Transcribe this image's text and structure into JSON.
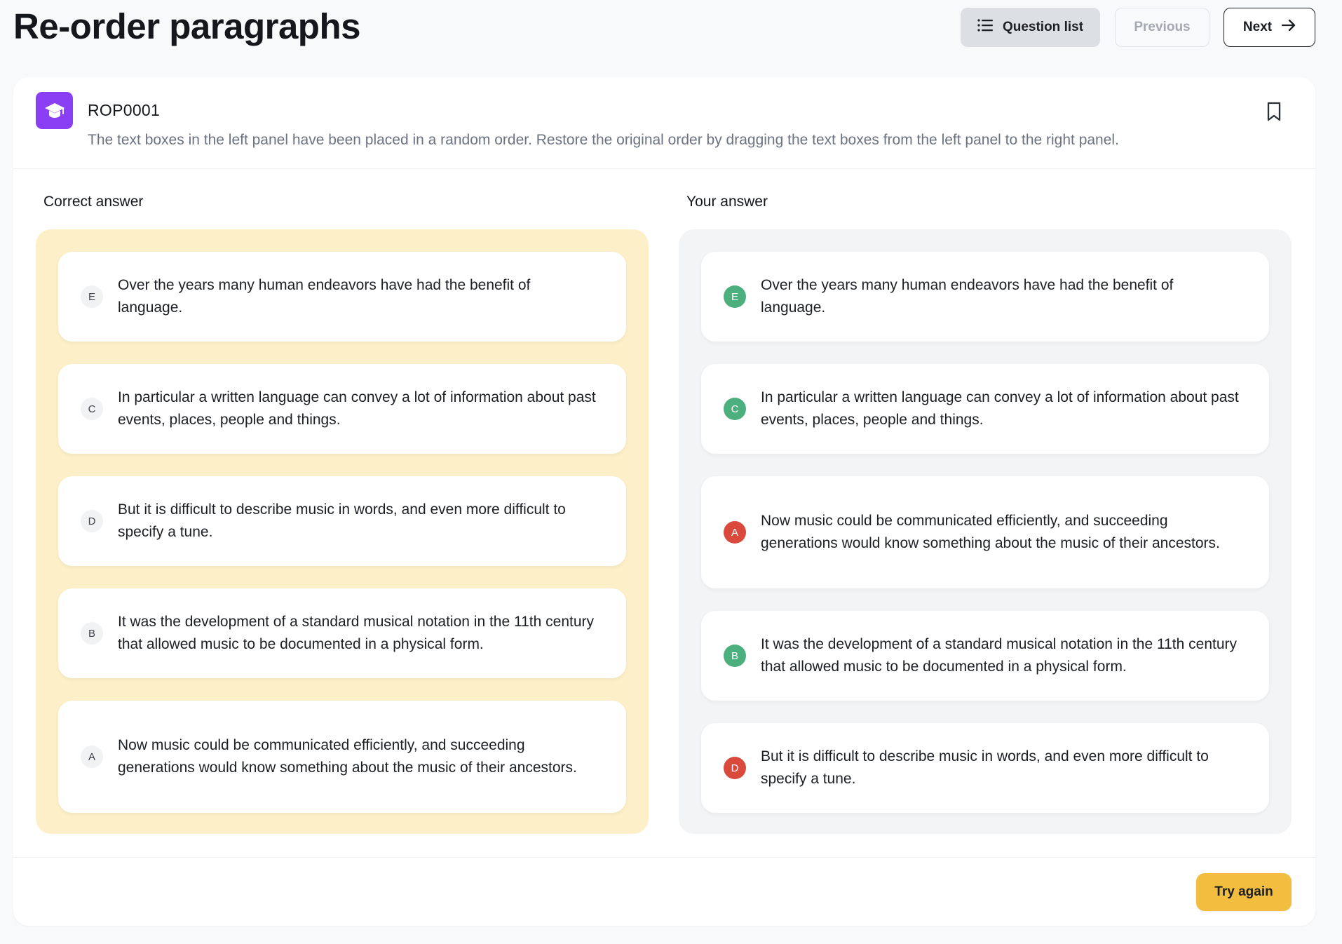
{
  "header": {
    "title": "Re-order paragraphs",
    "question_list_label": "Question list",
    "previous_label": "Previous",
    "next_label": "Next"
  },
  "question": {
    "id": "ROP0001",
    "instructions": "The text boxes in the left panel have been placed in a random order. Restore the original order by dragging the text boxes from the left panel to the right panel."
  },
  "correct_answer": {
    "title": "Correct answer",
    "items": [
      {
        "letter": "E",
        "text": "Over the years many human endeavors have had the benefit of language."
      },
      {
        "letter": "C",
        "text": "In particular a written language can convey a lot of information about past events, places, people and things."
      },
      {
        "letter": "D",
        "text": "But it is difficult to describe music in words, and even more difficult to specify a tune."
      },
      {
        "letter": "B",
        "text": "It was the development of a standard musical notation in the 11th century that allowed music to be documented in a physical form."
      },
      {
        "letter": "A",
        "text": "Now music could be communicated efficiently, and succeeding generations would know something about the music of their ancestors."
      }
    ]
  },
  "your_answer": {
    "title": "Your answer",
    "items": [
      {
        "letter": "E",
        "status": "correct",
        "text": "Over the years many human endeavors have had the benefit of language."
      },
      {
        "letter": "C",
        "status": "correct",
        "text": "In particular a written language can convey a lot of information about past events, places, people and things."
      },
      {
        "letter": "A",
        "status": "incorrect",
        "text": "Now music could be communicated efficiently, and succeeding generations would know something about the music of their ancestors."
      },
      {
        "letter": "B",
        "status": "correct",
        "text": "It was the development of a standard musical notation in the 11th century that allowed music to be documented in a physical form."
      },
      {
        "letter": "D",
        "status": "incorrect",
        "text": "But it is difficult to describe music in words, and even more difficult to specify a tune."
      }
    ]
  },
  "footer": {
    "try_again_label": "Try again"
  },
  "colors": {
    "accent_purple": "#8b3ff5",
    "correct_panel_bg": "#fdf0c8",
    "correct_badge": "#4caf7d",
    "incorrect_badge": "#d94a3d",
    "try_again_bg": "#f3bd40"
  },
  "icons": {
    "question_list": "list-icon",
    "next": "arrow-right-icon",
    "question_type": "graduation-cap-icon",
    "bookmark": "bookmark-icon"
  }
}
